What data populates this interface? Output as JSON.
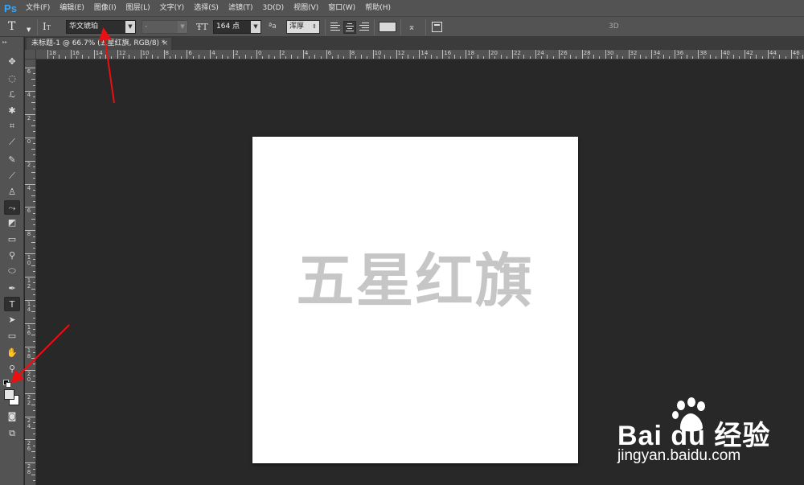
{
  "menu": {
    "logo": "Ps",
    "items": [
      "文件(F)",
      "编辑(E)",
      "图像(I)",
      "图层(L)",
      "文字(Y)",
      "选择(S)",
      "滤镜(T)",
      "3D(D)",
      "视图(V)",
      "窗口(W)",
      "帮助(H)"
    ]
  },
  "options": {
    "tool_glyph": "T",
    "font_family": "华文琥珀",
    "font_style": "-",
    "font_size": "164 点",
    "antialias": "浑厚",
    "three_d": "3D",
    "text_color": "#d9d9d9"
  },
  "tab": {
    "title": "未标题-1 @ 66.7% (五星红旗, RGB/8) *",
    "close": "×"
  },
  "rulers": {
    "horizontal": [
      "18",
      "16",
      "14",
      "12",
      "10",
      "8",
      "6",
      "4",
      "2",
      "0",
      "2",
      "4",
      "6",
      "8",
      "10",
      "12",
      "14",
      "16",
      "18",
      "20",
      "22",
      "24",
      "26",
      "28",
      "30",
      "32",
      "34",
      "36",
      "38",
      "40",
      "42",
      "44",
      "46"
    ],
    "vertical": [
      "6",
      "4",
      "2",
      "0",
      "2",
      "4",
      "6",
      "8",
      "1 0",
      "1 2",
      "1 4",
      "1 6",
      "1 8",
      "2 0",
      "2 2",
      "2 4",
      "2 6",
      "2 8"
    ]
  },
  "canvas": {
    "text": "五星红旗",
    "text_color": "#c6c6c6"
  },
  "watermark": {
    "brand": "Bai  du 经验",
    "url": "jingyan.baidu.com"
  },
  "annotation_color": "#e81010"
}
